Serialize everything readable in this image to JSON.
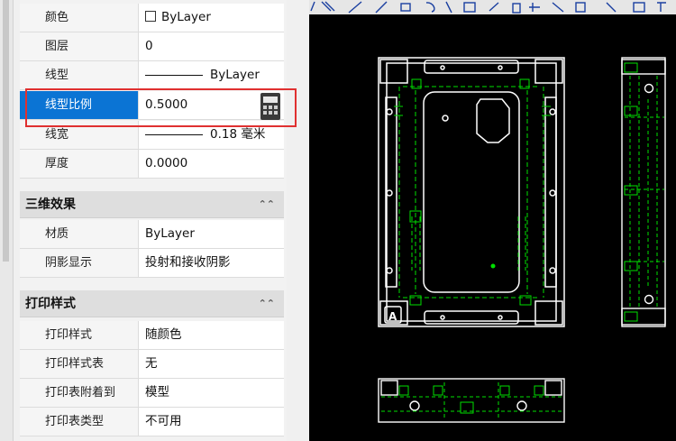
{
  "properties": {
    "general": [
      {
        "label": "颜色",
        "value": "ByLayer",
        "icon": "color-swatch-icon"
      },
      {
        "label": "图层",
        "value": "0"
      },
      {
        "label": "线型",
        "value": "ByLayer"
      },
      {
        "label": "线型比例",
        "value": "0.5000",
        "selected": true
      },
      {
        "label": "线宽",
        "value": "0.18 毫米"
      },
      {
        "label": "厚度",
        "value": "0.0000"
      }
    ],
    "sections": [
      {
        "title": "三维效果",
        "rows": [
          {
            "label": "材质",
            "value": "ByLayer"
          },
          {
            "label": "阴影显示",
            "value": "投射和接收阴影"
          }
        ]
      },
      {
        "title": "打印样式",
        "rows": [
          {
            "label": "打印样式",
            "value": "随颜色"
          },
          {
            "label": "打印样式表",
            "value": "无"
          },
          {
            "label": "打印表附着到",
            "value": "模型"
          },
          {
            "label": "打印表类型",
            "value": "不可用"
          }
        ]
      }
    ]
  },
  "drawing": {
    "title_block_letter": "A"
  },
  "colors": {
    "selection": "#0b74d4",
    "highlight": "#e03030",
    "canvas": "#000000",
    "drawing_white": "#ffffff",
    "drawing_green": "#00e000"
  },
  "icons": [
    "color-swatch-icon",
    "calculator-icon",
    "collapse-icon",
    "toolbar-icons"
  ]
}
